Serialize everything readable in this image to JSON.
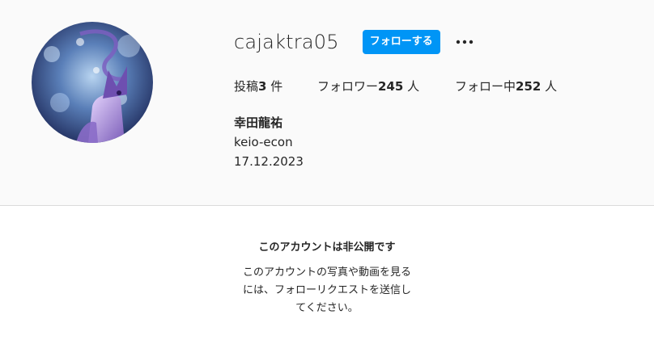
{
  "profile": {
    "username": "cajaktra05",
    "follow_label": "フォローする",
    "more_icon": "more-horizontal-icon",
    "stats": {
      "posts_label": "投稿",
      "posts_count": "3",
      "posts_unit": "件",
      "followers_label": "フォロワー",
      "followers_count": "245",
      "followers_unit": "人",
      "following_label": "フォロー中",
      "following_count": "252",
      "following_unit": "人"
    },
    "full_name": "幸田龍祐",
    "bio_line": "keio-econ",
    "bio_date": "17.12.2023"
  },
  "private": {
    "title": "このアカウントは非公開です",
    "desc_line1": "このアカウントの写真や動画を見る",
    "desc_line2": "には、フォローリクエストを送信し",
    "desc_line3": "てください。"
  },
  "colors": {
    "accent": "#0095f6",
    "header_bg": "#fafafa",
    "divider": "#dbdbdb",
    "text": "#262626"
  }
}
